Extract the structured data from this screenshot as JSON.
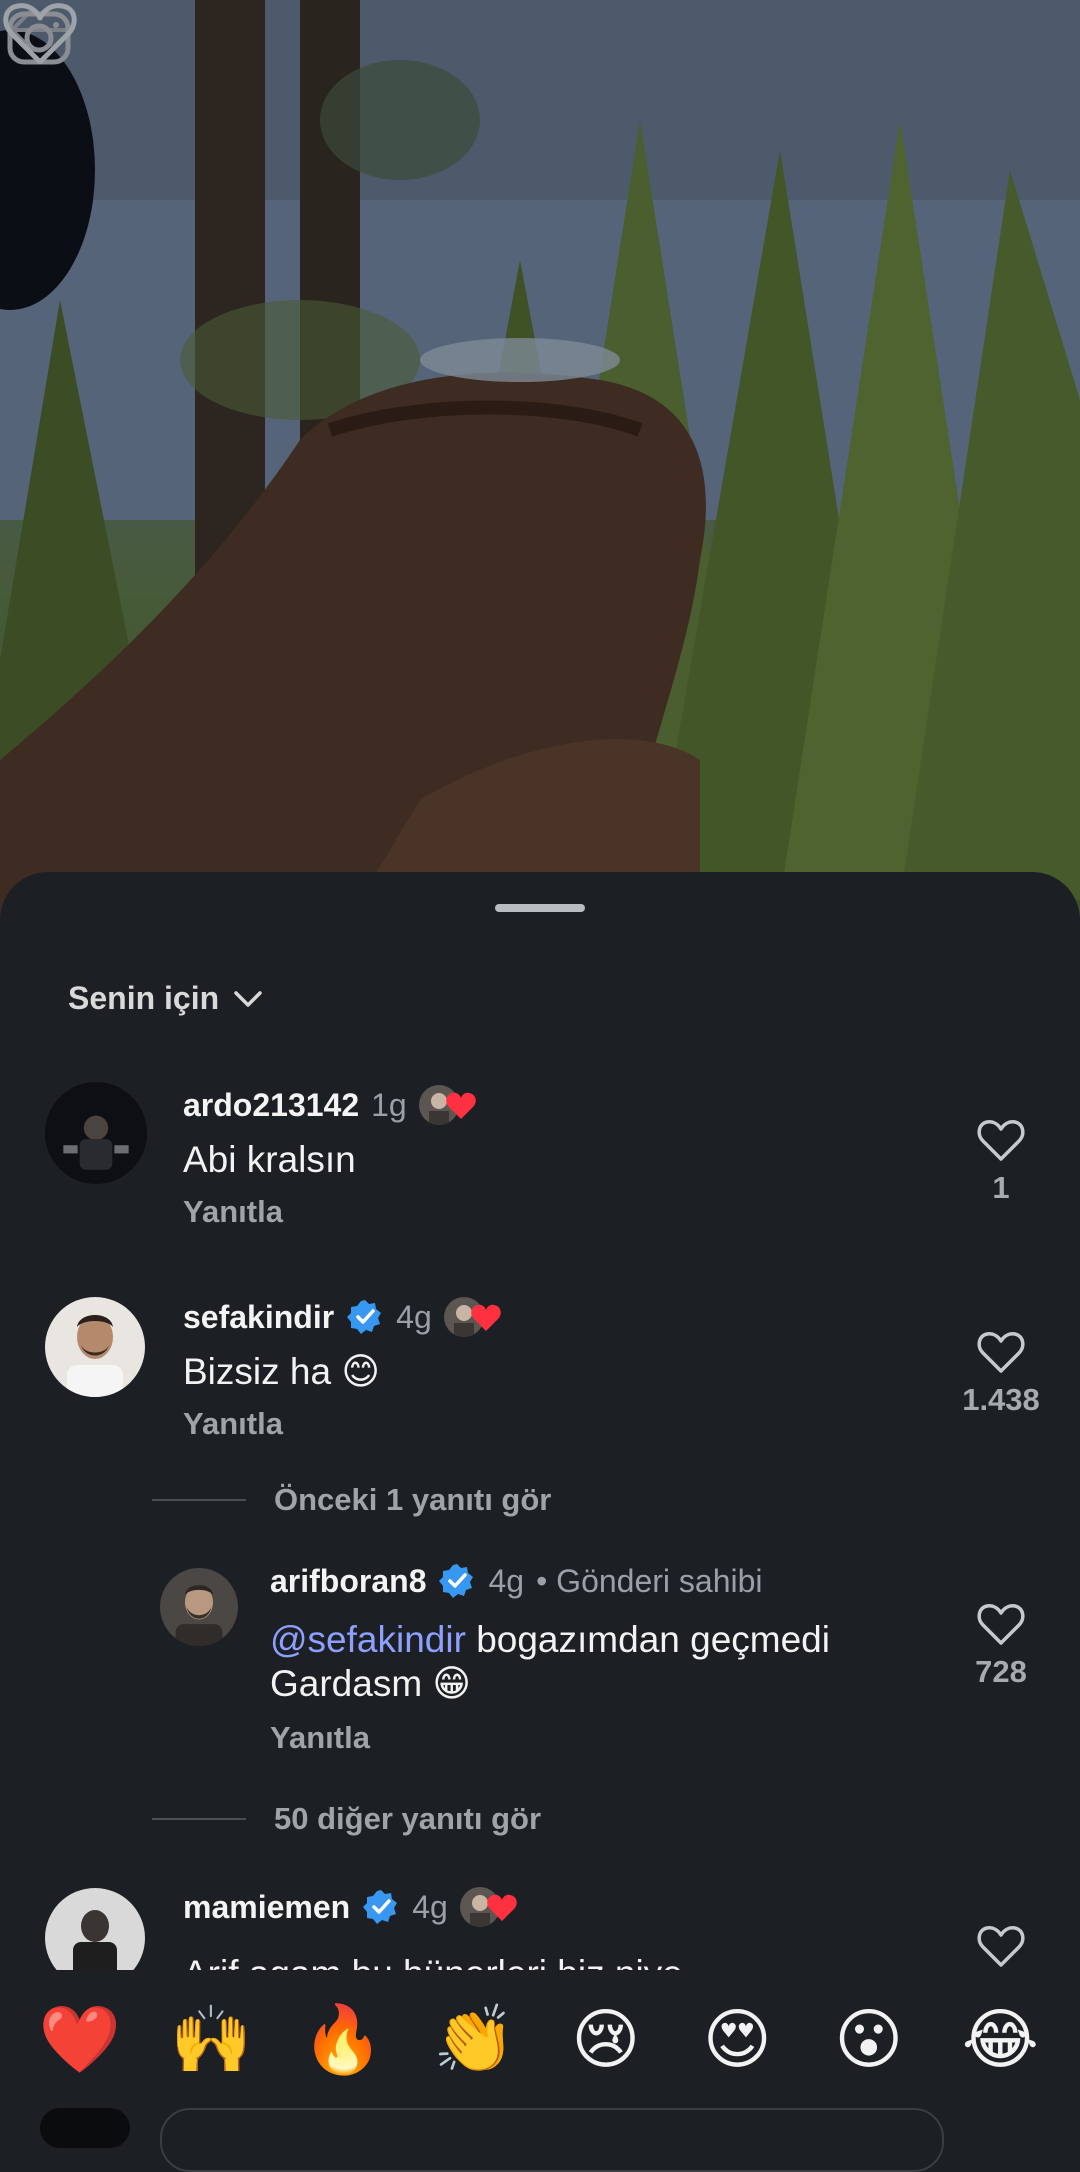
{
  "video": {
    "back_icon": "arrow-left-icon",
    "camera_icon": "camera-icon",
    "like_icon": "heart-outline-icon"
  },
  "sheet": {
    "filter_label": "Senin için",
    "filter_icon": "chevron-down-icon"
  },
  "comments": [
    {
      "username": "ardo213142",
      "time": "1g",
      "verified": false,
      "text": "Abi kralsın",
      "reply_label": "Yanıtla",
      "likes": "1",
      "liked_by_owner": true
    },
    {
      "username": "sefakindir",
      "time": "4g",
      "verified": true,
      "text": "Bizsiz ha 😊",
      "reply_label": "Yanıtla",
      "likes": "1.438",
      "liked_by_owner": true
    },
    {
      "username": "mamiemen",
      "time": "4g",
      "verified": true,
      "text": "Arif agam bu hünerleri biz niye",
      "reply_label": "Yanıtla",
      "likes": "",
      "liked_by_owner": true
    }
  ],
  "previous_replies_label": "Önceki 1 yanıtı gör",
  "reply": {
    "username": "arifboran8",
    "time": "4g",
    "owner_label": "• Gönderi sahibi",
    "mention": "@sefakindir",
    "text_line1": " bogazımdan geçmedi",
    "text_line2": "Gardasm 😁",
    "reply_label": "Yanıtla",
    "likes": "728"
  },
  "more_replies_label": "50 diğer yanıtı gör",
  "emoji_bar": [
    "❤️",
    "🙌",
    "🔥",
    "👏",
    "😢",
    "😍",
    "😮",
    "😂"
  ],
  "colors": {
    "background": "#1c1f23",
    "mention": "#8ea0ff",
    "verified": "#3897f0",
    "heart_red": "#ff3040"
  }
}
